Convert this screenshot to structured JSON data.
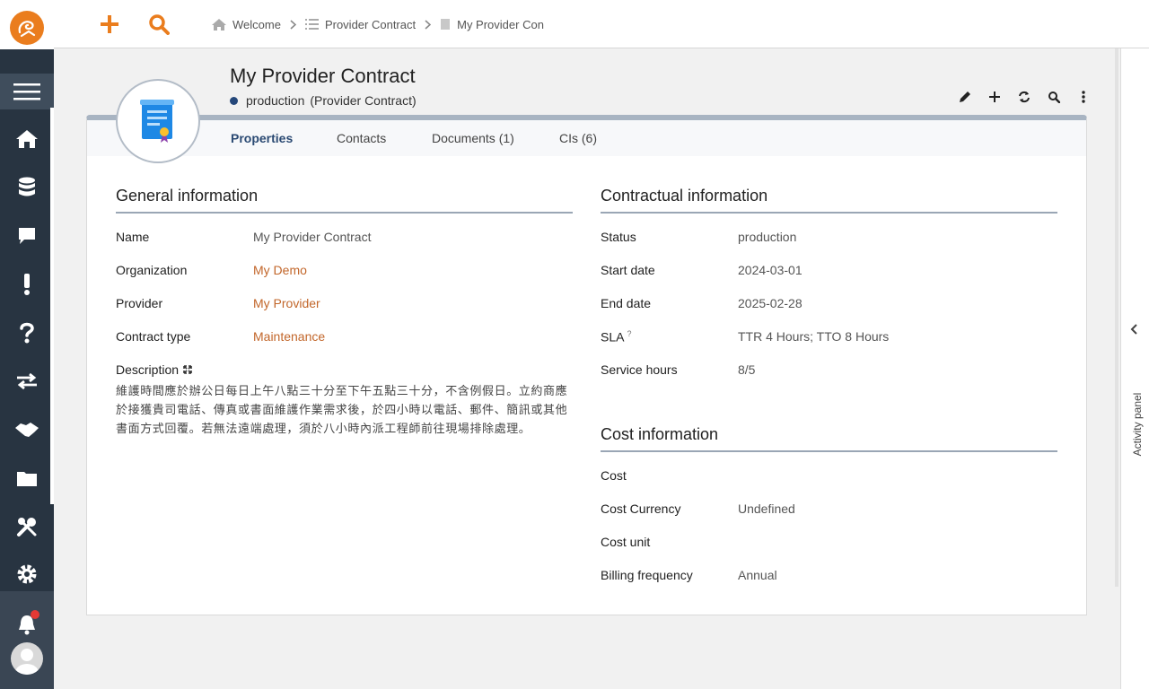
{
  "topbar": {
    "breadcrumbs": [
      "Welcome",
      "Provider Contract",
      "My Provider Con…"
    ]
  },
  "header": {
    "title": "My Provider Contract",
    "status": "production",
    "class_label": "(Provider Contract)",
    "status_color": "#24477a"
  },
  "tabs": [
    "Properties",
    "Contacts",
    "Documents (1)",
    "CIs (6)"
  ],
  "general": {
    "title": "General information",
    "rows": [
      {
        "label": "Name",
        "value": "My Provider Contract"
      },
      {
        "label": "Organization",
        "value": "My Demo"
      },
      {
        "label": "Provider",
        "value": "My Provider"
      },
      {
        "label": "Contract type",
        "value": "Maintenance"
      }
    ],
    "description_label": "Description",
    "description": "維護時間應於辦公日每日上午八點三十分至下午五點三十分，不含例假日。立約商應於接獲貴司電話、傳真或書面維護作業需求後，於四小時以電話、郵件、簡訊或其他書面方式回覆。若無法遠端處理，須於八小時內派工程師前往現場排除處理。"
  },
  "contractual": {
    "title": "Contractual information",
    "rows": [
      {
        "label": "Status",
        "value": "production"
      },
      {
        "label": "Start date",
        "value": "2024-03-01"
      },
      {
        "label": "End date",
        "value": "2025-02-28"
      },
      {
        "label": "SLA",
        "help": "?",
        "value": "TTR 4 Hours; TTO 8 Hours"
      },
      {
        "label": "Service hours",
        "value": "8/5"
      }
    ]
  },
  "cost": {
    "title": "Cost information",
    "rows": [
      {
        "label": "Cost",
        "value": ""
      },
      {
        "label": "Cost Currency",
        "value": "Undefined"
      },
      {
        "label": "Cost unit",
        "value": ""
      },
      {
        "label": "Billing frequency",
        "value": "Annual"
      }
    ]
  },
  "activity_panel": {
    "label": "Activity panel"
  },
  "colors": {
    "accent": "#ea7d1e",
    "link": "#c2662a",
    "sidebar": "#283441",
    "tab_active": "#2b4a73"
  }
}
